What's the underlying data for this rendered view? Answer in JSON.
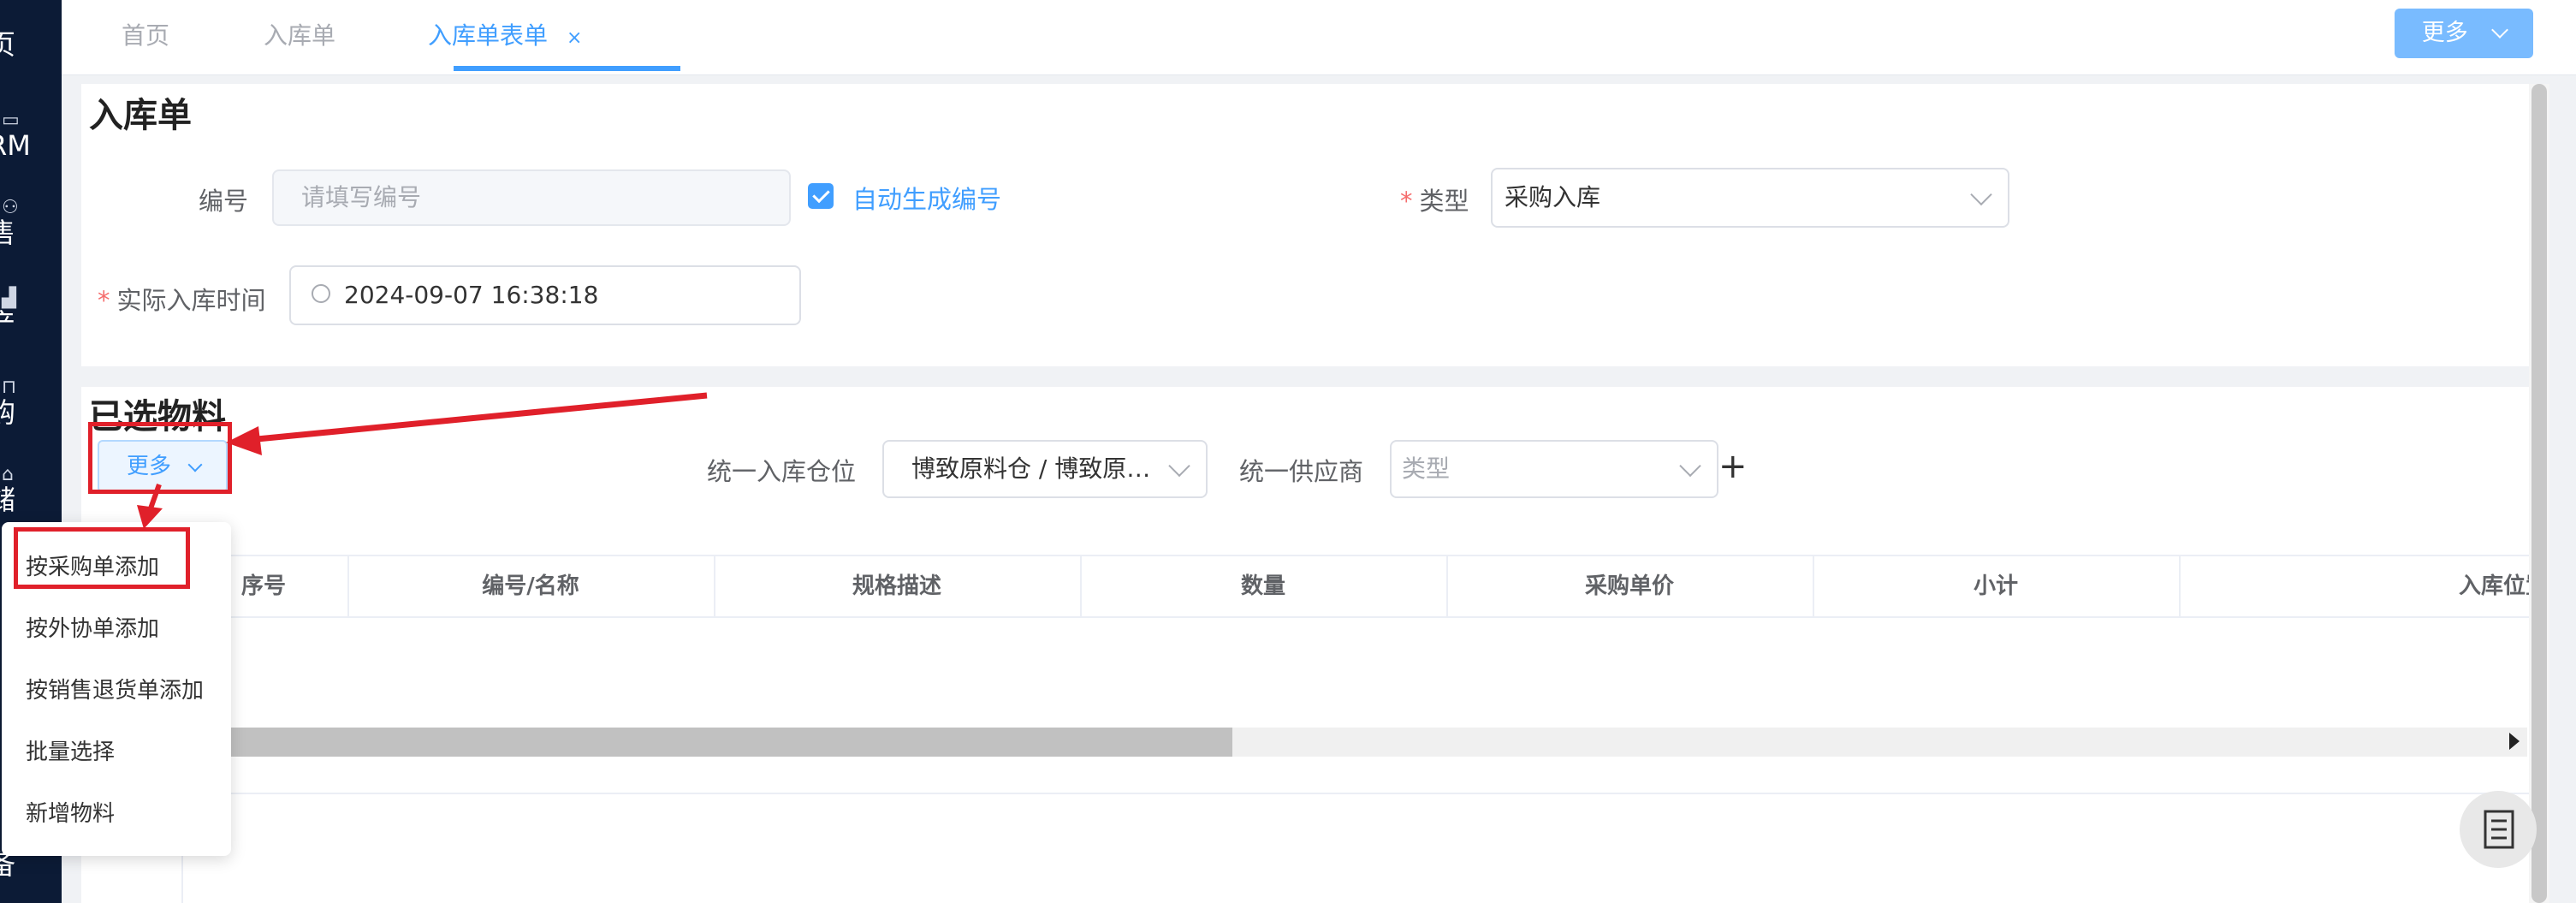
{
  "sidebar": {
    "items": [
      {
        "label": "页",
        "icon": "home-icon"
      },
      {
        "label": "RM",
        "icon": "crm-icon"
      },
      {
        "label": "售",
        "icon": "sales-icon"
      },
      {
        "label": "产",
        "icon": "production-icon"
      },
      {
        "label": "购",
        "icon": "purchase-icon"
      },
      {
        "label": "储",
        "icon": "warehouse-icon"
      },
      {
        "label": "备",
        "icon": "equipment-icon"
      }
    ]
  },
  "tabs": [
    {
      "label": "首页"
    },
    {
      "label": "入库单"
    },
    {
      "label": "入库单表单",
      "active": true,
      "close": "×"
    }
  ],
  "header": {
    "more_label": "更多"
  },
  "form": {
    "title": "入库单",
    "number_label": "编号",
    "number_placeholder": "请填写编号",
    "auto_generate_label": "自动生成编号",
    "auto_generate_checked": true,
    "type_label": "类型",
    "type_value": "采购入库",
    "time_label": "实际入库时间",
    "time_value": "2024-09-07 16:38:18",
    "required_mark": "*"
  },
  "materials": {
    "title": "已选物料",
    "more_label": "更多",
    "warehouse_label": "统一入库仓位",
    "warehouse_value": "博致原料仓 / 博致原…",
    "supplier_label": "统一供应商",
    "supplier_placeholder": "类型",
    "add_symbol": "+"
  },
  "table": {
    "columns": [
      "序号",
      "编号/名称",
      "规格描述",
      "数量",
      "采购单价",
      "小计",
      "入库位置"
    ]
  },
  "dropdown": {
    "items": [
      "按采购单添加",
      "按外协单添加",
      "按销售退货单添加",
      "批量选择",
      "新增物料"
    ],
    "highlighted_index": 0
  },
  "colors": {
    "primary": "#409eff",
    "sidebar": "#0c1b36",
    "annotation_red": "#e0202a",
    "required": "#f56c6c"
  }
}
